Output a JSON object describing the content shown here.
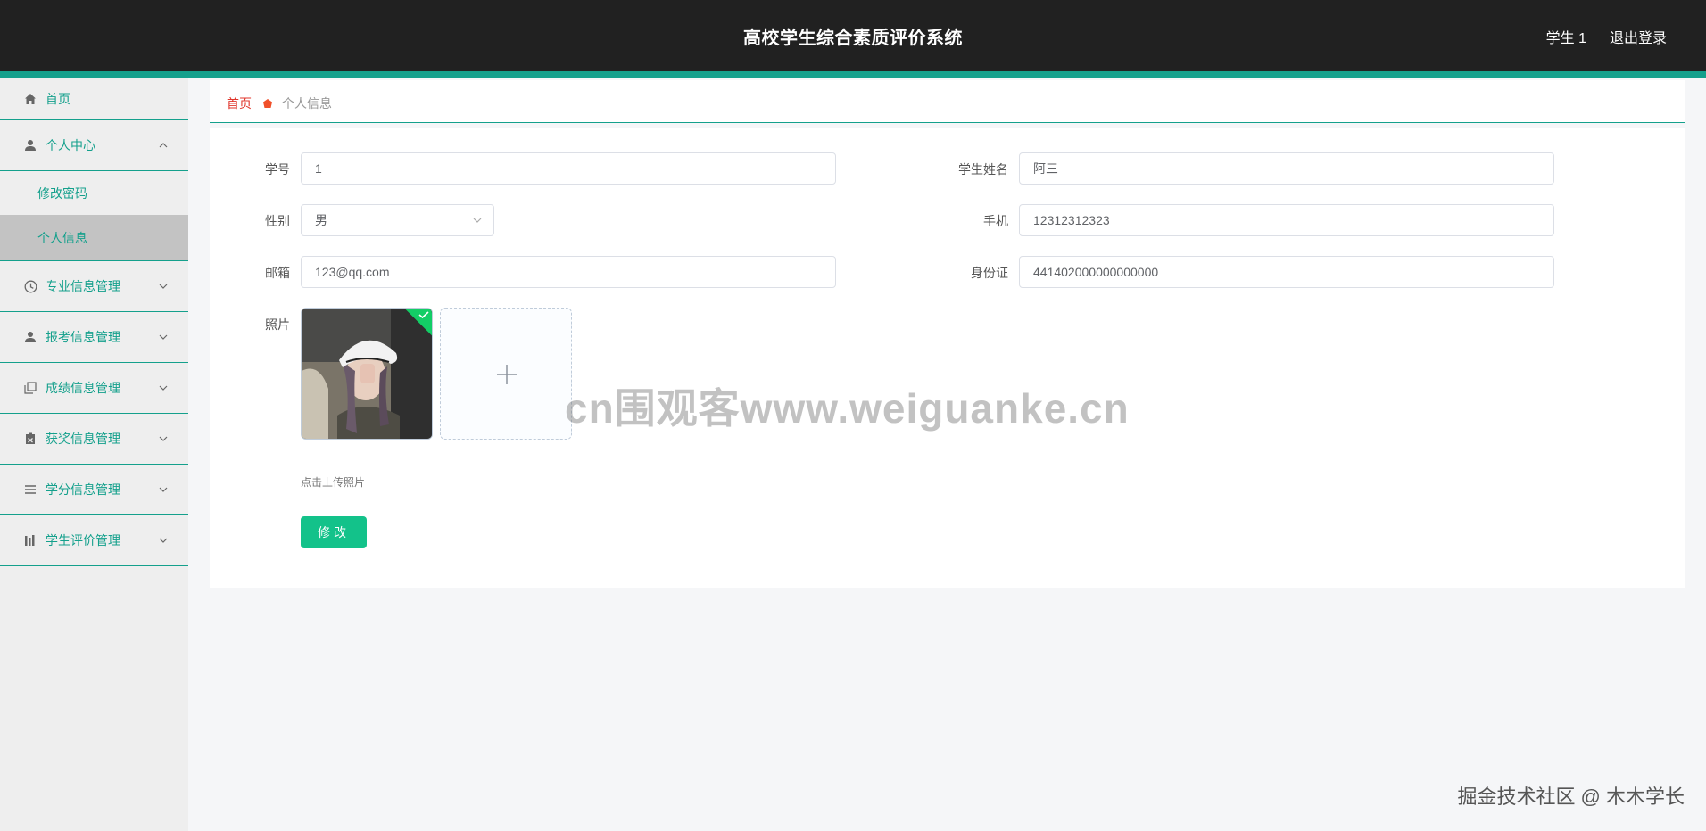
{
  "header": {
    "title": "高校学生综合素质评价系统",
    "user": "学生 1",
    "logout": "退出登录"
  },
  "sidebar": {
    "items": [
      {
        "label": "首页",
        "icon": "home-icon"
      },
      {
        "label": "个人中心",
        "icon": "user-icon",
        "expanded": true,
        "children": [
          {
            "label": "修改密码"
          },
          {
            "label": "个人信息",
            "active": true
          }
        ]
      },
      {
        "label": "专业信息管理",
        "icon": "clock-icon"
      },
      {
        "label": "报考信息管理",
        "icon": "user-icon"
      },
      {
        "label": "成绩信息管理",
        "icon": "copy-icon"
      },
      {
        "label": "获奖信息管理",
        "icon": "clipboard-icon"
      },
      {
        "label": "学分信息管理",
        "icon": "list-icon"
      },
      {
        "label": "学生评价管理",
        "icon": "chart-icon"
      }
    ]
  },
  "breadcrumb": {
    "home": "首页",
    "current": "个人信息"
  },
  "form": {
    "student_no_label": "学号",
    "student_no_value": "1",
    "name_label": "学生姓名",
    "name_value": "阿三",
    "gender_label": "性别",
    "gender_value": "男",
    "phone_label": "手机",
    "phone_value": "12312312323",
    "email_label": "邮箱",
    "email_value": "123@qq.com",
    "id_label": "身份证",
    "id_value": "441402000000000000",
    "photo_label": "照片",
    "upload_tip": "点击上传照片",
    "submit_label": "修改"
  },
  "watermark": "cn围观客www.weiguanke.cn",
  "footer_mark": "掘金技术社区 @ 木木学长",
  "colors": {
    "accent": "#14a08c",
    "header_bg": "#212121",
    "button": "#13c28a",
    "breadcrumb_home": "#e0352b"
  }
}
